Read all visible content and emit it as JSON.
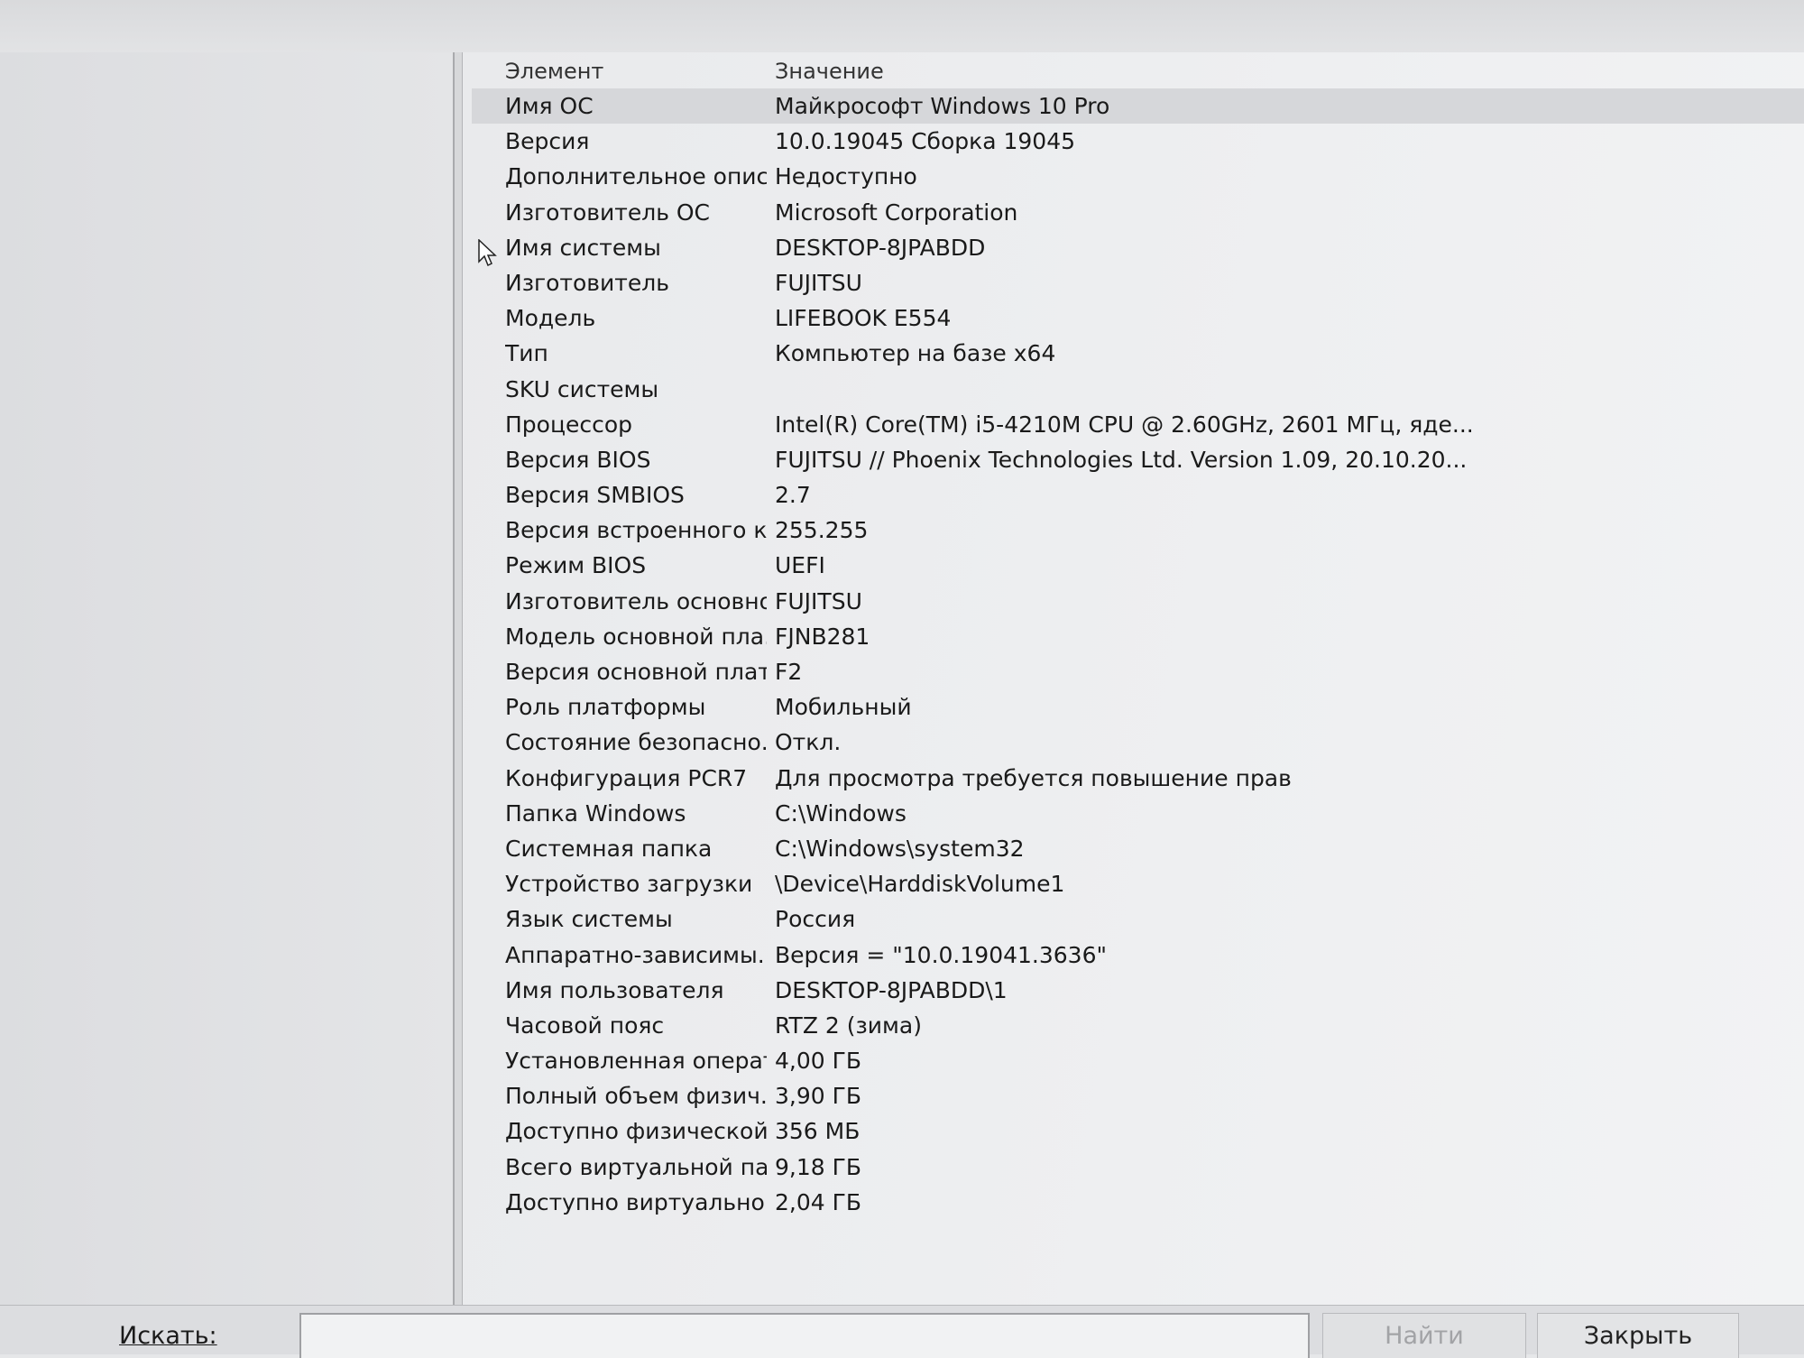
{
  "list": {
    "header": {
      "name": "Элемент",
      "value": "Значение"
    },
    "rows": [
      {
        "name": "Имя ОС",
        "value": "Майкрософт Windows 10 Pro"
      },
      {
        "name": "Версия",
        "value": "10.0.19045 Сборка 19045"
      },
      {
        "name": "Дополнительное опис...",
        "value": "Недоступно"
      },
      {
        "name": "Изготовитель ОС",
        "value": "Microsoft Corporation"
      },
      {
        "name": "Имя системы",
        "value": "DESKTOP-8JPABDD"
      },
      {
        "name": "Изготовитель",
        "value": "FUJITSU"
      },
      {
        "name": "Модель",
        "value": "LIFEBOOK E554"
      },
      {
        "name": "Тип",
        "value": "Компьютер на базе x64"
      },
      {
        "name": "SKU системы",
        "value": ""
      },
      {
        "name": "Процессор",
        "value": "Intel(R) Core(TM) i5-4210M CPU @ 2.60GHz, 2601 МГц, яде..."
      },
      {
        "name": "Версия BIOS",
        "value": "FUJITSU // Phoenix Technologies Ltd. Version 1.09, 20.10.20..."
      },
      {
        "name": "Версия SMBIOS",
        "value": "2.7"
      },
      {
        "name": "Версия встроенного к...",
        "value": "255.255"
      },
      {
        "name": "Режим BIOS",
        "value": "UEFI"
      },
      {
        "name": "Изготовитель основно...",
        "value": "FUJITSU"
      },
      {
        "name": "Модель основной пла...",
        "value": "FJNB281"
      },
      {
        "name": "Версия основной платы",
        "value": "F2"
      },
      {
        "name": "Роль платформы",
        "value": "Мобильный"
      },
      {
        "name": "Состояние безопасно...",
        "value": "Откл."
      },
      {
        "name": "Конфигурация PCR7",
        "value": "Для просмотра требуется повышение прав"
      },
      {
        "name": "Папка Windows",
        "value": "C:\\Windows"
      },
      {
        "name": "Системная папка",
        "value": "C:\\Windows\\system32"
      },
      {
        "name": "Устройство загрузки",
        "value": "\\Device\\HarddiskVolume1"
      },
      {
        "name": "Язык системы",
        "value": "Россия"
      },
      {
        "name": "Аппаратно-зависимы...",
        "value": "Версия = \"10.0.19041.3636\""
      },
      {
        "name": "Имя пользователя",
        "value": "DESKTOP-8JPABDD\\1"
      },
      {
        "name": "Часовой пояс",
        "value": "RTZ 2 (зима)"
      },
      {
        "name": "Установленная операт...",
        "value": "4,00 ГБ"
      },
      {
        "name": "Полный объем физич...",
        "value": "3,90 ГБ"
      },
      {
        "name": "Доступно физической ...",
        "value": "356 МБ"
      },
      {
        "name": "Всего виртуальной па...",
        "value": "9,18 ГБ"
      },
      {
        "name": "Доступно виртуально...",
        "value": "2,04 ГБ"
      }
    ]
  },
  "search": {
    "label": "Искать:",
    "value": "",
    "find_label": "Найти",
    "close_label": "Закрыть"
  }
}
